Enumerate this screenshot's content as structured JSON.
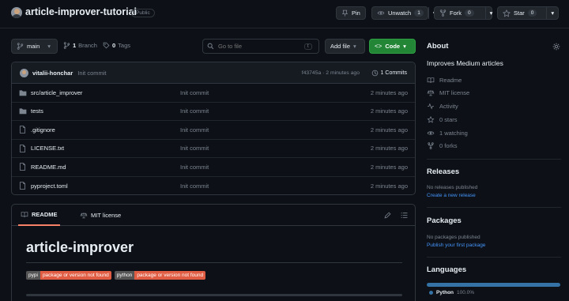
{
  "repo": {
    "name": "article-improver-tutorial",
    "visibility": "Public"
  },
  "actions": {
    "pin_label": "Pin",
    "unwatch_label": "Unwatch",
    "unwatch_count": "1",
    "fork_label": "Fork",
    "fork_count": "0",
    "star_label": "Star",
    "star_count": "0"
  },
  "toolbar": {
    "branch": "main",
    "branches_count": "1",
    "branches_label": "Branch",
    "tags_count": "0",
    "tags_label": "Tags",
    "search_placeholder": "Go to file",
    "search_shortcut": "t",
    "add_file_label": "Add file",
    "code_label": "Code"
  },
  "commit": {
    "author": "vitalii-honchar",
    "message": "Init commit",
    "meta": "f43745a · 2 minutes ago",
    "commits_label": "1 Commits"
  },
  "files": [
    {
      "name": "src/article_improver",
      "type": "folder",
      "message": "Init commit",
      "time": "2 minutes ago"
    },
    {
      "name": "tests",
      "type": "folder",
      "message": "Init commit",
      "time": "2 minutes ago"
    },
    {
      "name": ".gitignore",
      "type": "file",
      "message": "Init commit",
      "time": "2 minutes ago"
    },
    {
      "name": "LICENSE.txt",
      "type": "file",
      "message": "Init commit",
      "time": "2 minutes ago"
    },
    {
      "name": "README.md",
      "type": "file",
      "message": "Init commit",
      "time": "2 minutes ago"
    },
    {
      "name": "pyproject.toml",
      "type": "file",
      "message": "Init commit",
      "time": "2 minutes ago"
    }
  ],
  "readme": {
    "tab_readme": "README",
    "tab_license": "MIT license",
    "title": "article-improver",
    "badges": [
      {
        "left": "pypi",
        "right": "package or version not found"
      },
      {
        "left": "python",
        "right": "package or version not found"
      }
    ]
  },
  "about": {
    "title": "About",
    "description": "Improves Medium articles",
    "readme": "Readme",
    "license": "MIT license",
    "activity": "Activity",
    "stars": "0 stars",
    "watching": "1 watching",
    "forks": "0 forks"
  },
  "releases": {
    "title": "Releases",
    "empty": "No releases published",
    "link": "Create a new release"
  },
  "packages": {
    "title": "Packages",
    "empty": "No packages published",
    "link": "Publish your first package"
  },
  "languages": {
    "title": "Languages",
    "items": [
      {
        "name": "Python",
        "percent": "100.0%",
        "fraction": 1.0,
        "color": "#3572A5"
      }
    ]
  }
}
